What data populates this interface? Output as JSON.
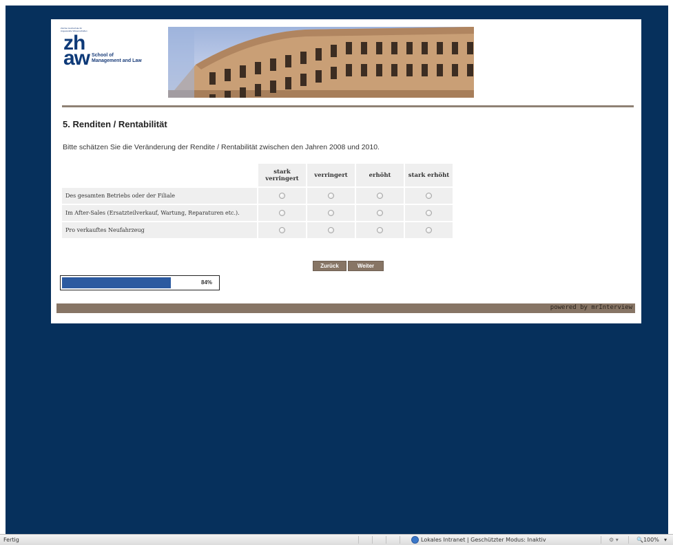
{
  "header": {
    "logo_tiny_text": "Zürcher Hochschule für Angewandte Wissenschaften",
    "logo_zh": "zh",
    "logo_aw": "aw",
    "logo_school": "School of\nManagement and Law"
  },
  "survey": {
    "section_title": "5. Renditen / Rentabilität",
    "question": "Bitte schätzen Sie die Veränderung der Rendite / Rentabilität zwischen den Jahren 2008 und 2010.",
    "columns": [
      "stark verringert",
      "verringert",
      "erhöht",
      "stark erhöht"
    ],
    "rows": [
      "Des gesamten Betriebs oder der Filiale",
      "Im After-Sales (Ersatzteilverkauf, Wartung, Reparaturen etc.).",
      "Pro verkauftes Neufahrzeug"
    ],
    "back_label": "Zurück",
    "next_label": "Weiter"
  },
  "progress": {
    "value": 0.84,
    "label": "84%"
  },
  "footer": {
    "powered_by": "powered by mrInterview"
  },
  "statusbar": {
    "status": "Fertig",
    "zone": "Lokales Intranet | Geschützter Modus: Inaktiv",
    "zoom": "100%"
  },
  "colors": {
    "background": "#06305c",
    "accent_brown": "#877565",
    "progress_blue": "#2c5aa0",
    "logo_blue": "#0e3a78"
  },
  "icons": [
    "radio-button-icon",
    "security-zone-icon",
    "tools-icon",
    "zoom-icon"
  ]
}
